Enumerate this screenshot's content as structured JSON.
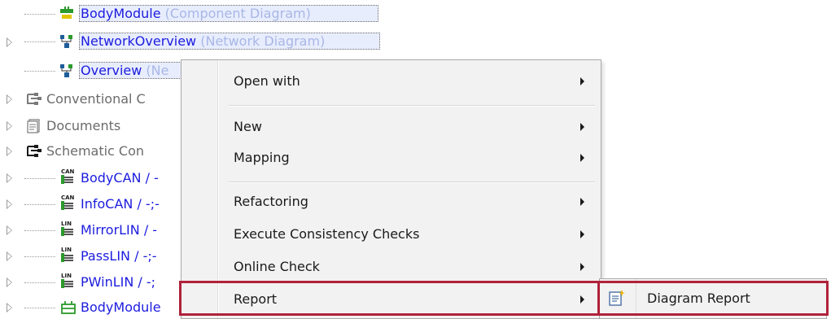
{
  "tree": {
    "items": [
      {
        "name": "BodyModule",
        "type": "(Component Diagram)"
      },
      {
        "name": "NetworkOverview",
        "type": "(Network Diagram)"
      },
      {
        "name": "Overview",
        "type": "(Ne"
      },
      {
        "label": "Conventional C"
      },
      {
        "label": "Documents"
      },
      {
        "label": "Schematic Con"
      },
      {
        "label": "BodyCAN / -"
      },
      {
        "label": "InfoCAN / -;-"
      },
      {
        "label": "MirrorLIN / -"
      },
      {
        "label": "PassLIN / -;-"
      },
      {
        "label": "PWinLIN / -;"
      },
      {
        "label": "BodyModule"
      }
    ],
    "icons": {
      "can": "CAN",
      "lin": "LIN"
    }
  },
  "menu": {
    "items": [
      {
        "label": "Open with"
      },
      {
        "label": "New"
      },
      {
        "label": "Mapping"
      },
      {
        "label": "Refactoring"
      },
      {
        "label": "Execute Consistency Checks"
      },
      {
        "label": "Online Check"
      },
      {
        "label": "Report"
      }
    ]
  },
  "submenu": {
    "items": [
      {
        "label": "Diagram Report"
      }
    ]
  },
  "colors": {
    "highlight_border": "#b0213a",
    "link_blue": "#1c1cdf",
    "type_blue": "#a8b7e6",
    "menu_bg": "#f2f2f2"
  }
}
